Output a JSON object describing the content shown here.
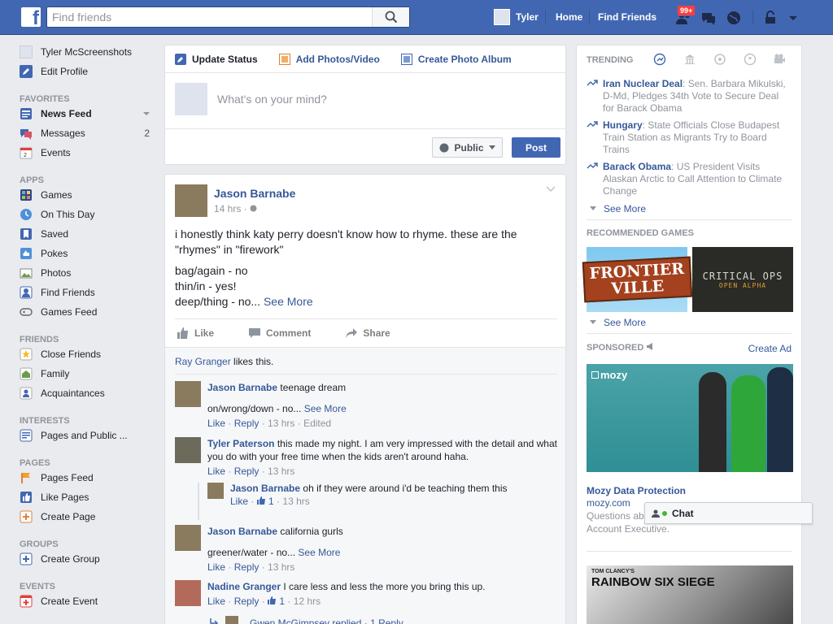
{
  "topbar": {
    "search_placeholder": "Find friends",
    "user_name": "Tyler",
    "home": "Home",
    "find_friends": "Find Friends",
    "friend_requests_badge": "99+"
  },
  "sidebar": {
    "profile_name": "Tyler McScreenshots",
    "edit_profile": "Edit Profile",
    "favorites_header": "FAVORITES",
    "favorites": [
      {
        "label": "News Feed",
        "icon": "news-feed-icon"
      },
      {
        "label": "Messages",
        "icon": "messages-icon",
        "count": "2"
      },
      {
        "label": "Events",
        "icon": "events-icon"
      }
    ],
    "apps_header": "APPS",
    "apps": [
      {
        "label": "Games",
        "icon": "games-icon"
      },
      {
        "label": "On This Day",
        "icon": "on-this-day-icon"
      },
      {
        "label": "Saved",
        "icon": "saved-icon"
      },
      {
        "label": "Pokes",
        "icon": "pokes-icon"
      },
      {
        "label": "Photos",
        "icon": "photos-icon"
      },
      {
        "label": "Find Friends",
        "icon": "find-friends-icon"
      },
      {
        "label": "Games Feed",
        "icon": "games-feed-icon"
      }
    ],
    "friends_header": "FRIENDS",
    "friends": [
      {
        "label": "Close Friends",
        "icon": "close-friends-icon"
      },
      {
        "label": "Family",
        "icon": "family-icon"
      },
      {
        "label": "Acquaintances",
        "icon": "acquaintances-icon"
      }
    ],
    "interests_header": "INTERESTS",
    "interests": [
      {
        "label": "Pages and Public ...",
        "icon": "pages-public-icon"
      }
    ],
    "pages_header": "PAGES",
    "pages": [
      {
        "label": "Pages Feed",
        "icon": "pages-feed-icon"
      },
      {
        "label": "Like Pages",
        "icon": "like-pages-icon"
      },
      {
        "label": "Create Page",
        "icon": "create-page-icon"
      }
    ],
    "groups_header": "GROUPS",
    "groups": [
      {
        "label": "Create Group",
        "icon": "create-group-icon"
      }
    ],
    "events_header": "EVENTS",
    "events": [
      {
        "label": "Create Event",
        "icon": "create-event-icon"
      }
    ]
  },
  "composer": {
    "tab_update_status": "Update Status",
    "tab_add_photos": "Add Photos/Video",
    "tab_create_album": "Create Photo Album",
    "placeholder": "What's on your mind?",
    "privacy": "Public",
    "post": "Post"
  },
  "post": {
    "author": "Jason Barnabe",
    "time": "14 hrs",
    "line1": "i honestly think katy perry doesn't know how to rhyme. these are the \"rhymes\" in \"firework\"",
    "line2": "bag/again - no",
    "line3": "thin/in - yes!",
    "line4": "deep/thing - no...",
    "see_more": "See More",
    "like": "Like",
    "comment": "Comment",
    "share": "Share",
    "likes_name": "Ray Granger",
    "likes_suffix": "likes this."
  },
  "comments": [
    {
      "name": "Jason Barnabe",
      "text": "teenage dream",
      "text2": "on/wrong/down - no...",
      "see_more": "See More",
      "like": "Like",
      "reply": "Reply",
      "time": "13 hrs",
      "edited": "Edited"
    },
    {
      "name": "Tyler Paterson",
      "text": "this made my night. I am very impressed with the detail and what you do with your free time when the kids aren't around haha.",
      "like": "Like",
      "reply": "Reply",
      "time": "13 hrs"
    },
    {
      "name": "Jason Barnabe",
      "text": "oh if they were around i'd be teaching them this",
      "like": "Like",
      "like_count": "1",
      "time": "13 hrs"
    },
    {
      "name": "Jason Barnabe",
      "text": "california gurls",
      "text2": "greener/water - no...",
      "see_more": "See More",
      "like": "Like",
      "reply": "Reply",
      "time": "13 hrs"
    },
    {
      "name": "Nadine Granger",
      "text": "I care less and less the more you bring this up.",
      "like": "Like",
      "reply": "Reply",
      "like_count": "1",
      "time": "12 hrs"
    },
    {
      "name": "Gwen McGimpsey replied",
      "text": "1 Reply"
    }
  ],
  "trending": {
    "header": "TRENDING",
    "items": [
      {
        "title": "Iran Nuclear Deal",
        "desc": ": Sen. Barbara Mikulski, D-Md, Pledges 34th Vote to Secure Deal for Barack Obama"
      },
      {
        "title": "Hungary",
        "desc": ": State Officials Close Budapest Train Station as Migrants Try to Board Trains"
      },
      {
        "title": "Barack Obama",
        "desc": ": US President Visits Alaskan Arctic to Call Attention to Climate Change"
      }
    ],
    "see_more": "See More"
  },
  "games": {
    "header": "RECOMMENDED GAMES",
    "game1": "FRONTIER VILLE",
    "game2_a": "CRITICAL OPS",
    "game2_b": "OPEN ALPHA",
    "see_more": "See More"
  },
  "sponsored": {
    "header": "SPONSORED",
    "create_ad": "Create Ad",
    "brand": "mozy",
    "title": "Mozy Data Protection",
    "url": "mozy.com",
    "desc": "Questions ab",
    "desc2": "Account Executive.",
    "ad2": "RAINBOW SIX SIEGE",
    "ad2_small": "TOM CLANCY'S"
  },
  "chat": {
    "label": "Chat"
  },
  "colors": {
    "brand": "#4267b2",
    "link": "#365899",
    "badge": "#fa3e3e"
  }
}
